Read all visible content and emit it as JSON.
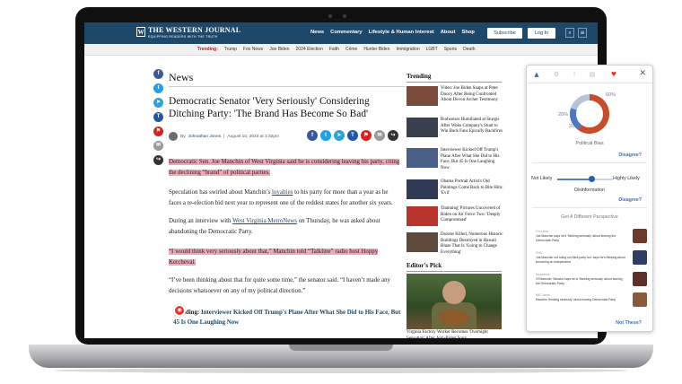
{
  "site": {
    "logo_mark": "W",
    "logo_text": "THE WESTERN JOURNAL",
    "tagline": "EQUIPPING READERS WITH THE TRUTH",
    "nav": [
      "News",
      "Commentary",
      "Lifestyle & Human Interest",
      "About",
      "Shop"
    ],
    "subscribe_label": "Subscribe",
    "login_label": "Log In",
    "search_icon": "⌕",
    "menu_icon": "≡"
  },
  "topic_bar": {
    "trending_label": "Trending:",
    "topics": [
      "Trump",
      "Fox News",
      "Joe Biden",
      "2024 Election",
      "Faith",
      "Crime",
      "Hunter Biden",
      "Immigration",
      "LGBT",
      "Sports",
      "Death"
    ]
  },
  "article": {
    "section": "News",
    "headline": "Democratic Senator 'Very Seriously' Considering Ditching Party: 'The Brand Has Become So Bad'",
    "by_prefix": "By",
    "author": "Johnathan Jones",
    "date": "August 10, 2023 at 1:32pm",
    "p1": "Democratic Sen. Joe Manchin of West Virginia said he is considering leaving his party, citing the declining “brand” of political parties.",
    "p2_before": "Speculation has swirled about Manchin’s ",
    "p2_link": "loyalties",
    "p2_after": " to his party for more than a year as he faces a re-election bid next year to represent one of the reddest states for another six years.",
    "p3_before": "During an interview with ",
    "p3_link": "West Virginia MetroNews",
    "p3_after": " on Thursday, he was asked about abandoning the Democratic Party.",
    "p4": "“I would think very seriously about that,” Manchin told “Talkline” radio host Hoppy Kercheval.",
    "p5": "“I’ve been thinking about that for quite some time,” the senator said. “I haven’t made any decisions whatsoever on any of my political direction.”",
    "trending_label": "Trending:",
    "trending_link": "Interviewer Kicked Off Trump's Plane After What She Did to His Face, But 45 Is One Laughing Now"
  },
  "sidebar": {
    "trending_title": "Trending",
    "items": [
      "Video: Joe Biden Snaps at Peter Doocy After Being Confronted About Devon Archer Testimony",
      "Budweiser Humiliated at Sturgis After Woke Company's Stunt to Win Back Fans Epically Backfires",
      "Interviewer Kicked Off Trump's Plane After What She Did to His Face, But 45 Is One Laughing Now",
      "Obama Portrait Artist's Old Paintings Come Back to Bite Him: 'Evil'",
      "'Damning' Pictures Uncovered of Biden on Air Force Two: 'Deeply Compromised'",
      "Dozens Killed, Numerous Historic Buildings Destroyed in Hawaii Blaze That Is 'Going to Change Everything'"
    ],
    "thumb_colors": [
      "#7a4b3b",
      "#3a3f4e",
      "#4a5f86",
      "#2f3b55",
      "#b8352e",
      "#5d4a3c"
    ],
    "picks_title": "Editor's Pick",
    "pick_caption": "Virginia Factory Worker Becomes 'Overnight Sensation' After Anti-Biden Song..."
  },
  "extension": {
    "tabs": [
      "▲",
      "⚙",
      "!",
      "▤",
      "♥"
    ],
    "close_icon": "✕",
    "bias": {
      "left_pct": 20,
      "center_pct": 20,
      "right_pct": 60
    },
    "bias_labels": {
      "left": "20%",
      "center": "20%",
      "right": "60%"
    },
    "colors": {
      "left": "#4a78c2",
      "center": "#b7c3d6",
      "right": "#c84b2a",
      "accent": "#3b6fb6"
    },
    "bias_title": "Political Bias",
    "disagree_label": "Disagree?",
    "not_likely": "Not Likely",
    "highly_likely": "Highly Likely",
    "disinformation_level": 0.62,
    "disinfo_title": "Disinformation",
    "perspective_title": "Get A Different Perspective",
    "perspectives": [
      {
        "source": "Fox News",
        "text": "Joe Manchin says he's 'thinking seriously' about leaving the Democratic Party",
        "thumb": "#6b3a2a"
      },
      {
        "source": "CNN",
        "text": "Joe Manchin not ruling out third-party run, says he's thinking about becoming an independent",
        "thumb": "#2e3e63"
      },
      {
        "source": "Newsweek",
        "text": "Of Manchin: Senator says he is 'thinking seriously' about leaving the Democratic Party",
        "thumb": "#5b2f2a"
      },
      {
        "source": "NBC News",
        "text": "Manchin 'thinking seriously' about leaving Democratic Party",
        "thumb": "#8a5a3c"
      }
    ],
    "not_these_label": "Not These?"
  },
  "share_icons": [
    "f",
    "t",
    "➤",
    "T",
    "⚑",
    "✉",
    "↪"
  ],
  "notify_icon": "◉"
}
